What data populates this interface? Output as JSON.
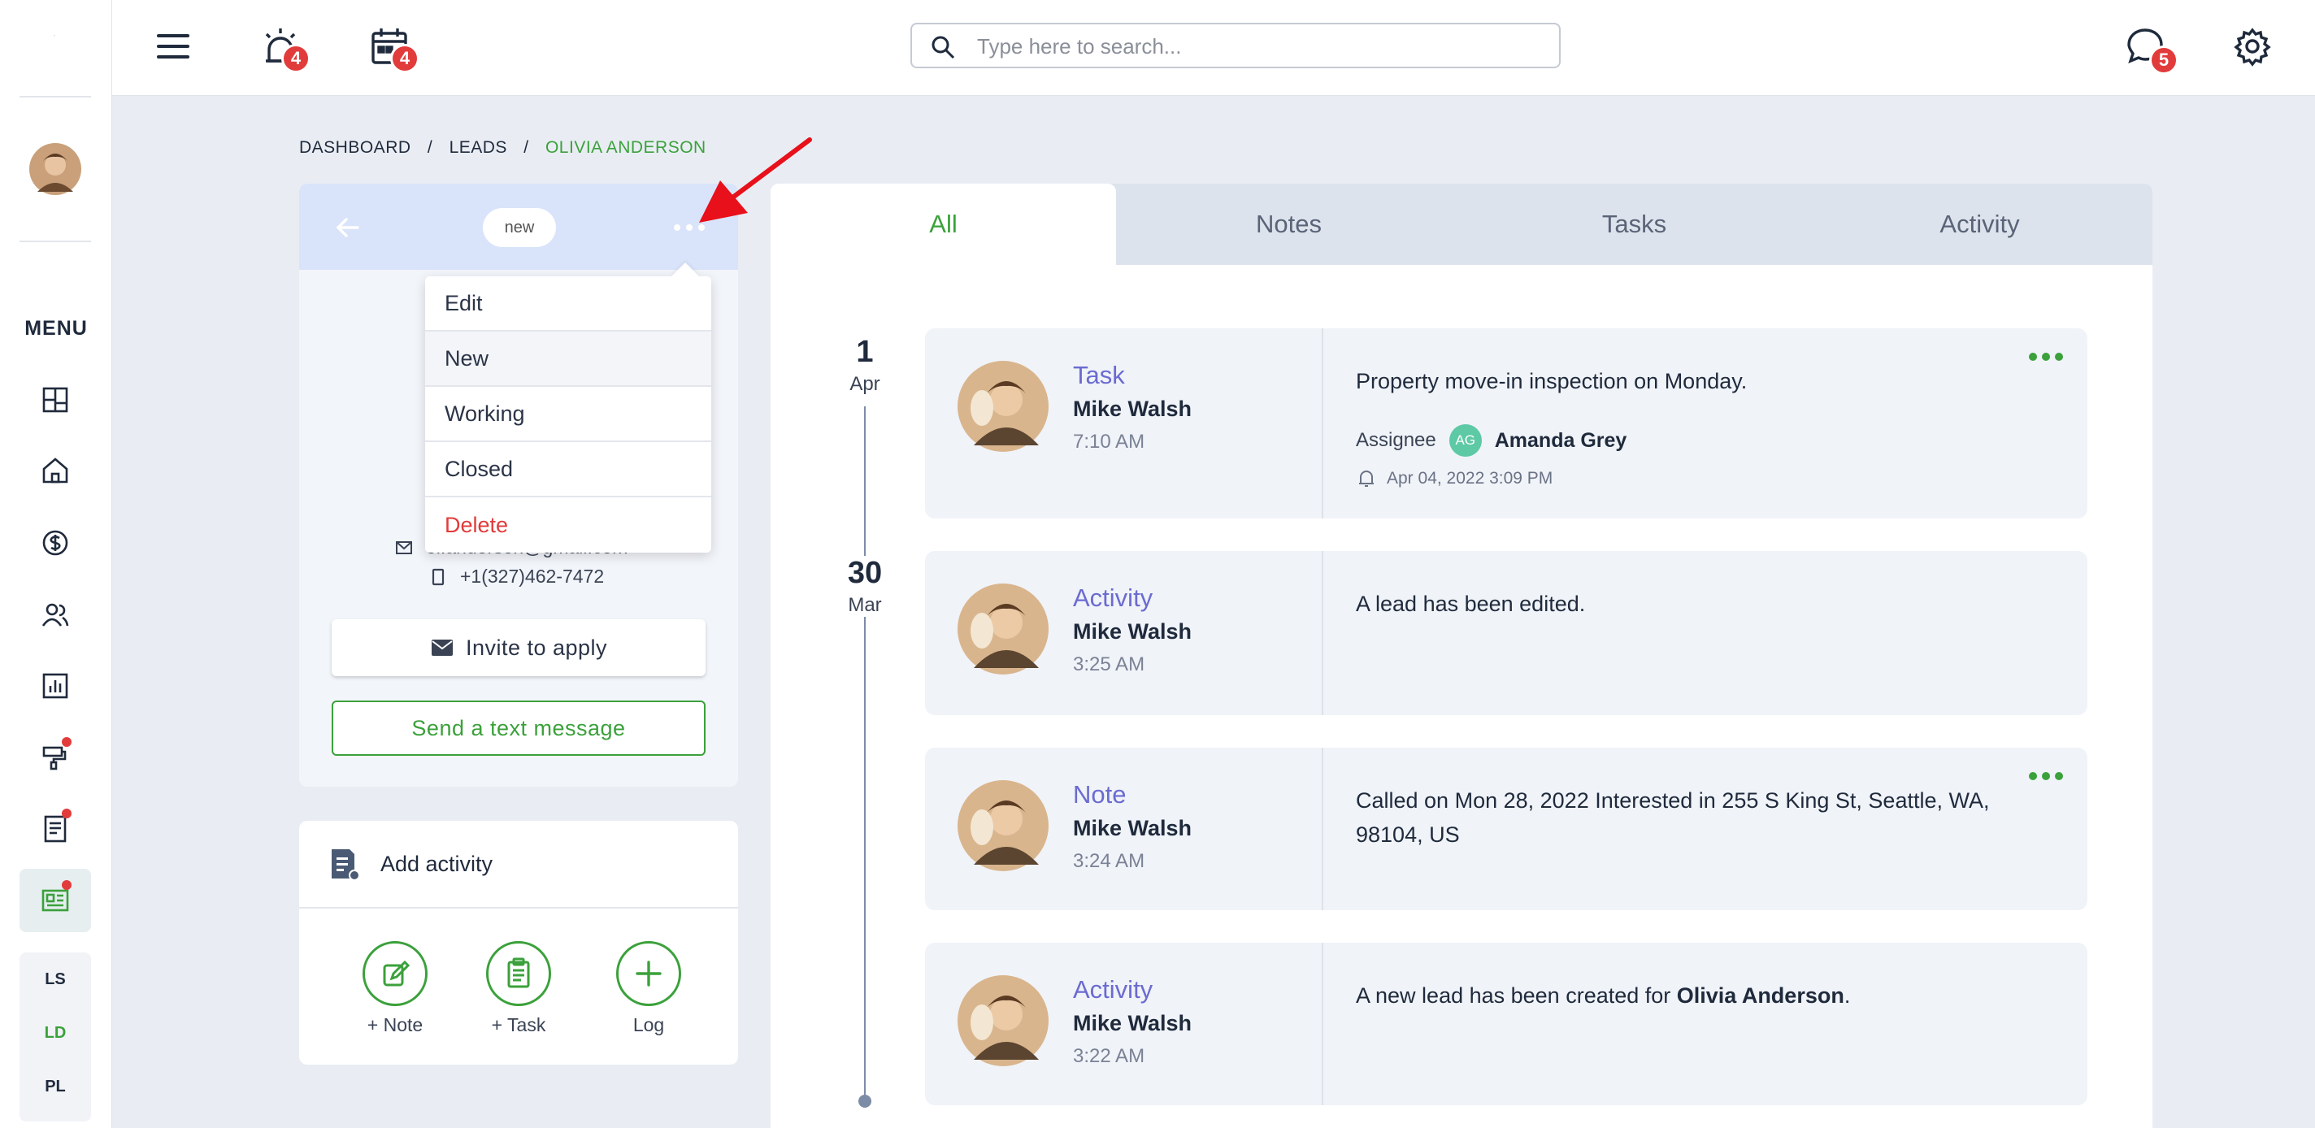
{
  "rail": {
    "menu_label": "MENU",
    "switches": [
      "LS",
      "LD",
      "PL"
    ],
    "active_switch": "LD"
  },
  "topbar": {
    "alarm_badge": "4",
    "calendar_badge": "4",
    "chat_badge": "5",
    "search_placeholder": "Type here to search..."
  },
  "breadcrumb": {
    "items": [
      "DASHBOARD",
      "/",
      "LEADS",
      "/",
      "OLIVIA ANDERSON"
    ]
  },
  "lead": {
    "status": "new",
    "email_partial": "ol.anderson@gmail.com",
    "phone": "+1(327)462-7472",
    "invite_label": "Invite to apply",
    "text_label": "Send a text message"
  },
  "dropdown": {
    "items": [
      "Edit",
      "New",
      "Working",
      "Closed",
      "Delete"
    ]
  },
  "add_activity": {
    "title": "Add activity",
    "buttons": [
      "+ Note",
      "+ Task",
      "Log"
    ]
  },
  "tabs": [
    "All",
    "Notes",
    "Tasks",
    "Activity"
  ],
  "dates": [
    {
      "day": "1",
      "month": "Apr"
    },
    {
      "day": "30",
      "month": "Mar"
    }
  ],
  "entries": [
    {
      "kind": "Task",
      "who": "Mike Walsh",
      "time": "7:10 AM",
      "text": "Property move-in inspection on Monday.",
      "assignee_label": "Assignee",
      "assignee_initials": "AG",
      "assignee_name": "Amanda Grey",
      "reminder": "Apr 04, 2022 3:09 PM"
    },
    {
      "kind": "Activity",
      "who": "Mike Walsh",
      "time": "3:25 AM",
      "text": "A lead has been edited."
    },
    {
      "kind": "Note",
      "who": "Mike Walsh",
      "time": "3:24 AM",
      "text": "Called on Mon 28, 2022 Interested in 255 S King St, Seattle, WA, 98104, US"
    },
    {
      "kind": "Activity",
      "who": "Mike Walsh",
      "time": "3:22 AM",
      "text_prefix": "A new lead has been created for ",
      "text_bold": "Olivia Anderson",
      "text_suffix": "."
    }
  ],
  "colors": {
    "accent_green": "#3ba13b",
    "badge_red": "#e23b3b",
    "kind_purple": "#6b6bd1",
    "lead_header_blue": "#d9e4fa"
  }
}
